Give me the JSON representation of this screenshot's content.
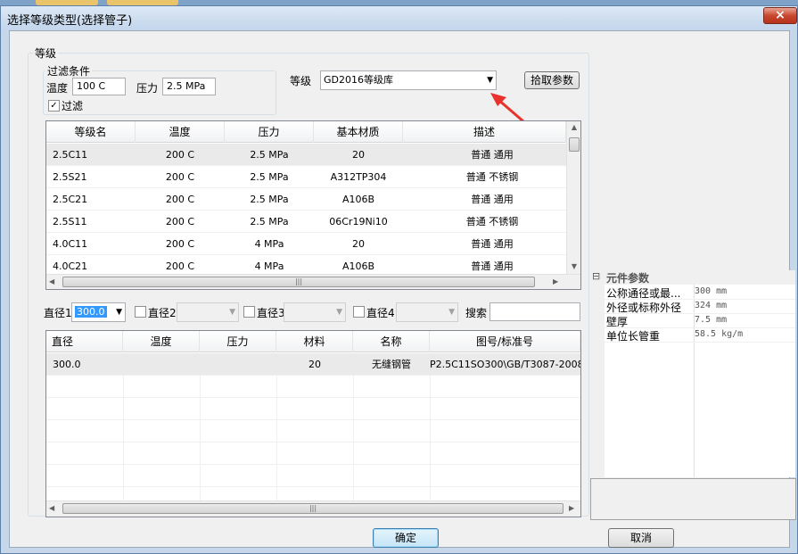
{
  "window": {
    "title": "选择等级类型(选择管子)",
    "close_icon": "×"
  },
  "grade_group": {
    "label": "等级",
    "filter": {
      "label": "过滤条件",
      "temperature_label": "温度",
      "temperature_value": "100 C",
      "pressure_label": "压力",
      "pressure_value": "2.5 MPa",
      "filter_checkbox_label": "过滤",
      "filter_checked": true
    },
    "library_label": "等级",
    "library_value": "GD2016等级库",
    "pick_params_button": "拾取参数"
  },
  "grade_table": {
    "columns": [
      "等级名",
      "温度",
      "压力",
      "基本材质",
      "描述"
    ],
    "rows": [
      [
        "2.5C11",
        "200 C",
        "2.5 MPa",
        "20",
        "普通 通用"
      ],
      [
        "2.5S21",
        "200 C",
        "2.5 MPa",
        "A312TP304",
        "普通 不锈钢"
      ],
      [
        "2.5C21",
        "200 C",
        "2.5 MPa",
        "A106B",
        "普通 通用"
      ],
      [
        "2.5S11",
        "200 C",
        "2.5 MPa",
        "06Cr19Ni10",
        "普通 不锈钢"
      ],
      [
        "4.0C11",
        "200 C",
        "4 MPa",
        "20",
        "普通 通用"
      ],
      [
        "4.0C21",
        "200 C",
        "4 MPa",
        "A106B",
        "普通 通用"
      ]
    ]
  },
  "diameter_filters": {
    "d1_label": "直径1",
    "d1_value": "300.0",
    "d2_label": "直径2",
    "d3_label": "直径3",
    "d4_label": "直径4",
    "search_label": "搜索",
    "search_value": ""
  },
  "component_table": {
    "columns": [
      "直径",
      "温度",
      "压力",
      "材料",
      "名称",
      "图号/标准号"
    ],
    "rows": [
      [
        "300.0",
        "",
        "",
        "20",
        "无缝钢管",
        "P2.5C11SO300\\GB/T3087-2008"
      ]
    ]
  },
  "properties": {
    "header": "元件参数",
    "items": [
      {
        "name": "公称通径或最...",
        "value": "300 mm"
      },
      {
        "name": "外径或标称外径",
        "value": "324 mm"
      },
      {
        "name": "壁厚",
        "value": "7.5 mm"
      },
      {
        "name": "单位长管重",
        "value": "58.5 kg/m"
      }
    ]
  },
  "buttons": {
    "ok": "确定",
    "cancel": "取消"
  },
  "colors": {
    "annotation_arrow": "#e8322b",
    "selected_row": "#eaeaea",
    "title_bar": "#c3d6ec"
  }
}
